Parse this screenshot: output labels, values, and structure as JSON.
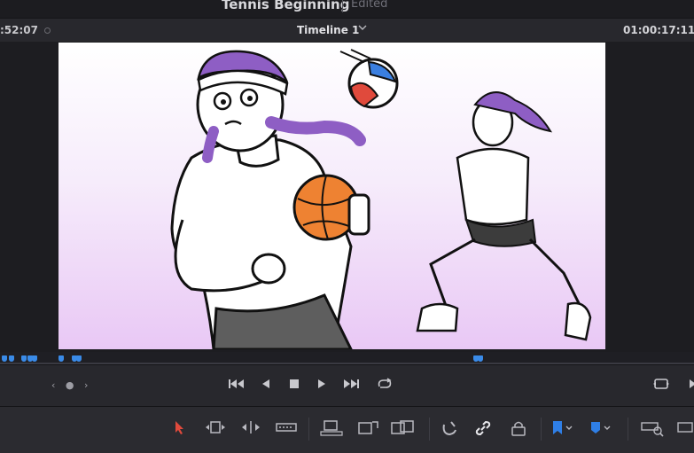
{
  "title_bar": {
    "project_name": "Tennis Beginning",
    "status": "Edited"
  },
  "viewer_header": {
    "timecode_left": ":52:07",
    "timeline_name": "Timeline 1",
    "timecode_right": "01:00:17:11"
  },
  "transport": {
    "jog_label": "‹ ● ›"
  },
  "colors": {
    "marker_blue": "#3a8be8",
    "selection_red": "#e04a3c",
    "flag_blue": "#2f7fe6",
    "background": "#1e1e22"
  },
  "icons": {
    "transport": [
      "jump-start-icon",
      "step-back-icon",
      "stop-icon",
      "play-icon",
      "jump-end-icon",
      "loop-icon",
      "fullscreen-icon"
    ],
    "toolbar": [
      "selection-arrow-icon",
      "trim-edit-icon",
      "dynamic-trim-icon",
      "blade-icon",
      "insert-clip-icon",
      "overwrite-clip-icon",
      "replace-clip-icon",
      "snapping-icon",
      "linked-selection-icon",
      "position-lock-icon",
      "flag-icon",
      "marker-icon",
      "zoom-icon"
    ]
  }
}
